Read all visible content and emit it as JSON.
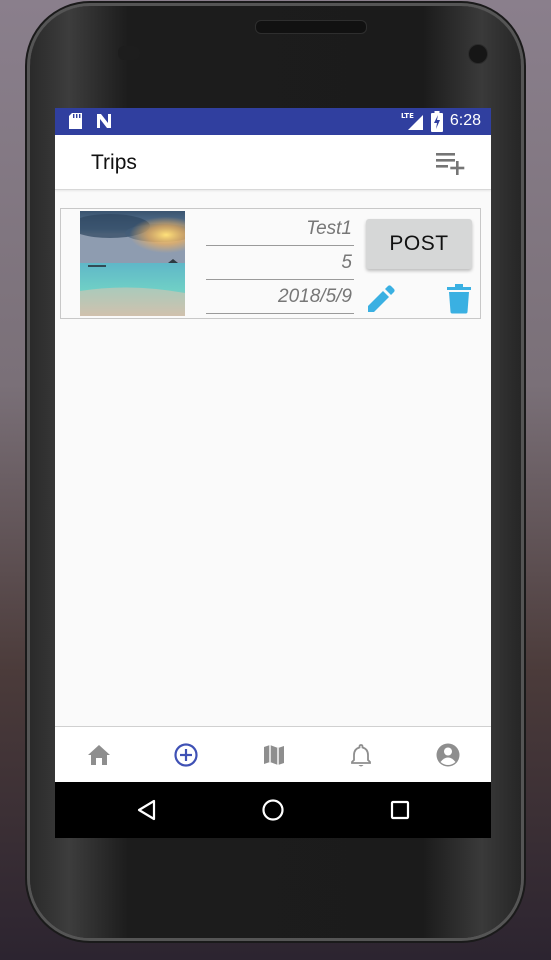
{
  "status_bar": {
    "time": "6:28",
    "network": "LTE",
    "icons": [
      "sd-card-icon",
      "n-notification-icon",
      "lte-signal-icon",
      "battery-charging-icon"
    ],
    "color": "#303f9f"
  },
  "app_bar": {
    "title": "Trips",
    "action_icon": "add-to-list-icon"
  },
  "trips": [
    {
      "name": "Test1",
      "days": "5",
      "date": "2018/5/9",
      "post_label": "POST",
      "edit_icon": "pencil-icon",
      "delete_icon": "trash-icon"
    }
  ],
  "bottom_nav": {
    "items": [
      "home-icon",
      "add-circle-icon",
      "map-icon",
      "bell-icon",
      "account-icon"
    ],
    "selected": "add-circle-icon",
    "selected_color": "#3f51b5"
  },
  "colors": {
    "accent": "#3ab0e2",
    "button_bg": "#d6d7d7"
  }
}
